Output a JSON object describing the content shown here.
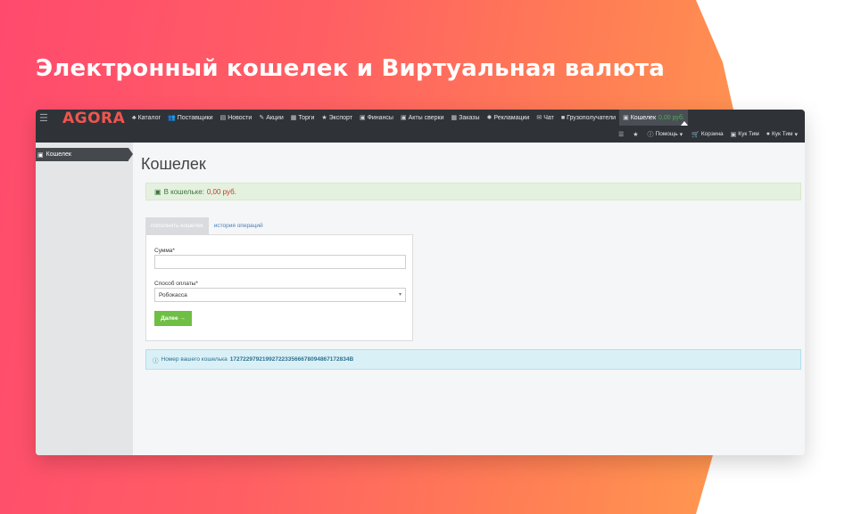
{
  "headline": "Электронный кошелек и Виртуальная валюта",
  "logo": "AGORA",
  "nav": {
    "items": [
      {
        "icon": "sitemap-icon",
        "glyph": "♣",
        "label": "Каталог"
      },
      {
        "icon": "users-icon",
        "glyph": "👥",
        "label": "Поставщики"
      },
      {
        "icon": "file-icon",
        "glyph": "▤",
        "label": "Новости"
      },
      {
        "icon": "tag-icon",
        "glyph": "✎",
        "label": "Акции"
      },
      {
        "icon": "list-icon",
        "glyph": "▦",
        "label": "Торги"
      },
      {
        "icon": "star-icon",
        "glyph": "★",
        "label": "Экспорт"
      },
      {
        "icon": "money-icon",
        "glyph": "▣",
        "label": "Финансы"
      },
      {
        "icon": "money-icon",
        "glyph": "▣",
        "label": "Акты сверки"
      },
      {
        "icon": "list-icon",
        "glyph": "▦",
        "label": "Заказы"
      },
      {
        "icon": "gear-icon",
        "glyph": "✹",
        "label": "Рекламации"
      },
      {
        "icon": "chat-icon",
        "glyph": "✉",
        "label": "Чат"
      },
      {
        "icon": "truck-icon",
        "glyph": "■",
        "label": "Грузополучатели"
      }
    ],
    "active": {
      "icon": "wallet-icon",
      "glyph": "▣",
      "label": "Кошелек",
      "balance": "0,00 руб."
    },
    "right": {
      "list_glyph": "☰",
      "star_glyph": "★",
      "help": "Помощь",
      "cart": "Корзина",
      "company": "Кук Тим",
      "user": "Кук Тим"
    }
  },
  "sidebar": {
    "items": [
      {
        "label": "Кошелек"
      }
    ]
  },
  "page": {
    "title": "Кошелек",
    "balance_label": "В кошельке:",
    "balance_value": "0,00 руб.",
    "tabs": {
      "topup": "пополнить кошелек",
      "history": "история операций"
    },
    "form": {
      "amount_label": "Сумма*",
      "amount_value": "",
      "method_label": "Способ оплаты*",
      "method_value": "Робокасса",
      "next_button": "Далее →"
    },
    "wallet_info_label": "Номер вашего кошелька",
    "wallet_number": "1727229792199272233566678094867172834В"
  },
  "colors": {
    "accent_green": "#6fbf44",
    "navbar": "#2f3338",
    "logo": "#f0554e"
  }
}
